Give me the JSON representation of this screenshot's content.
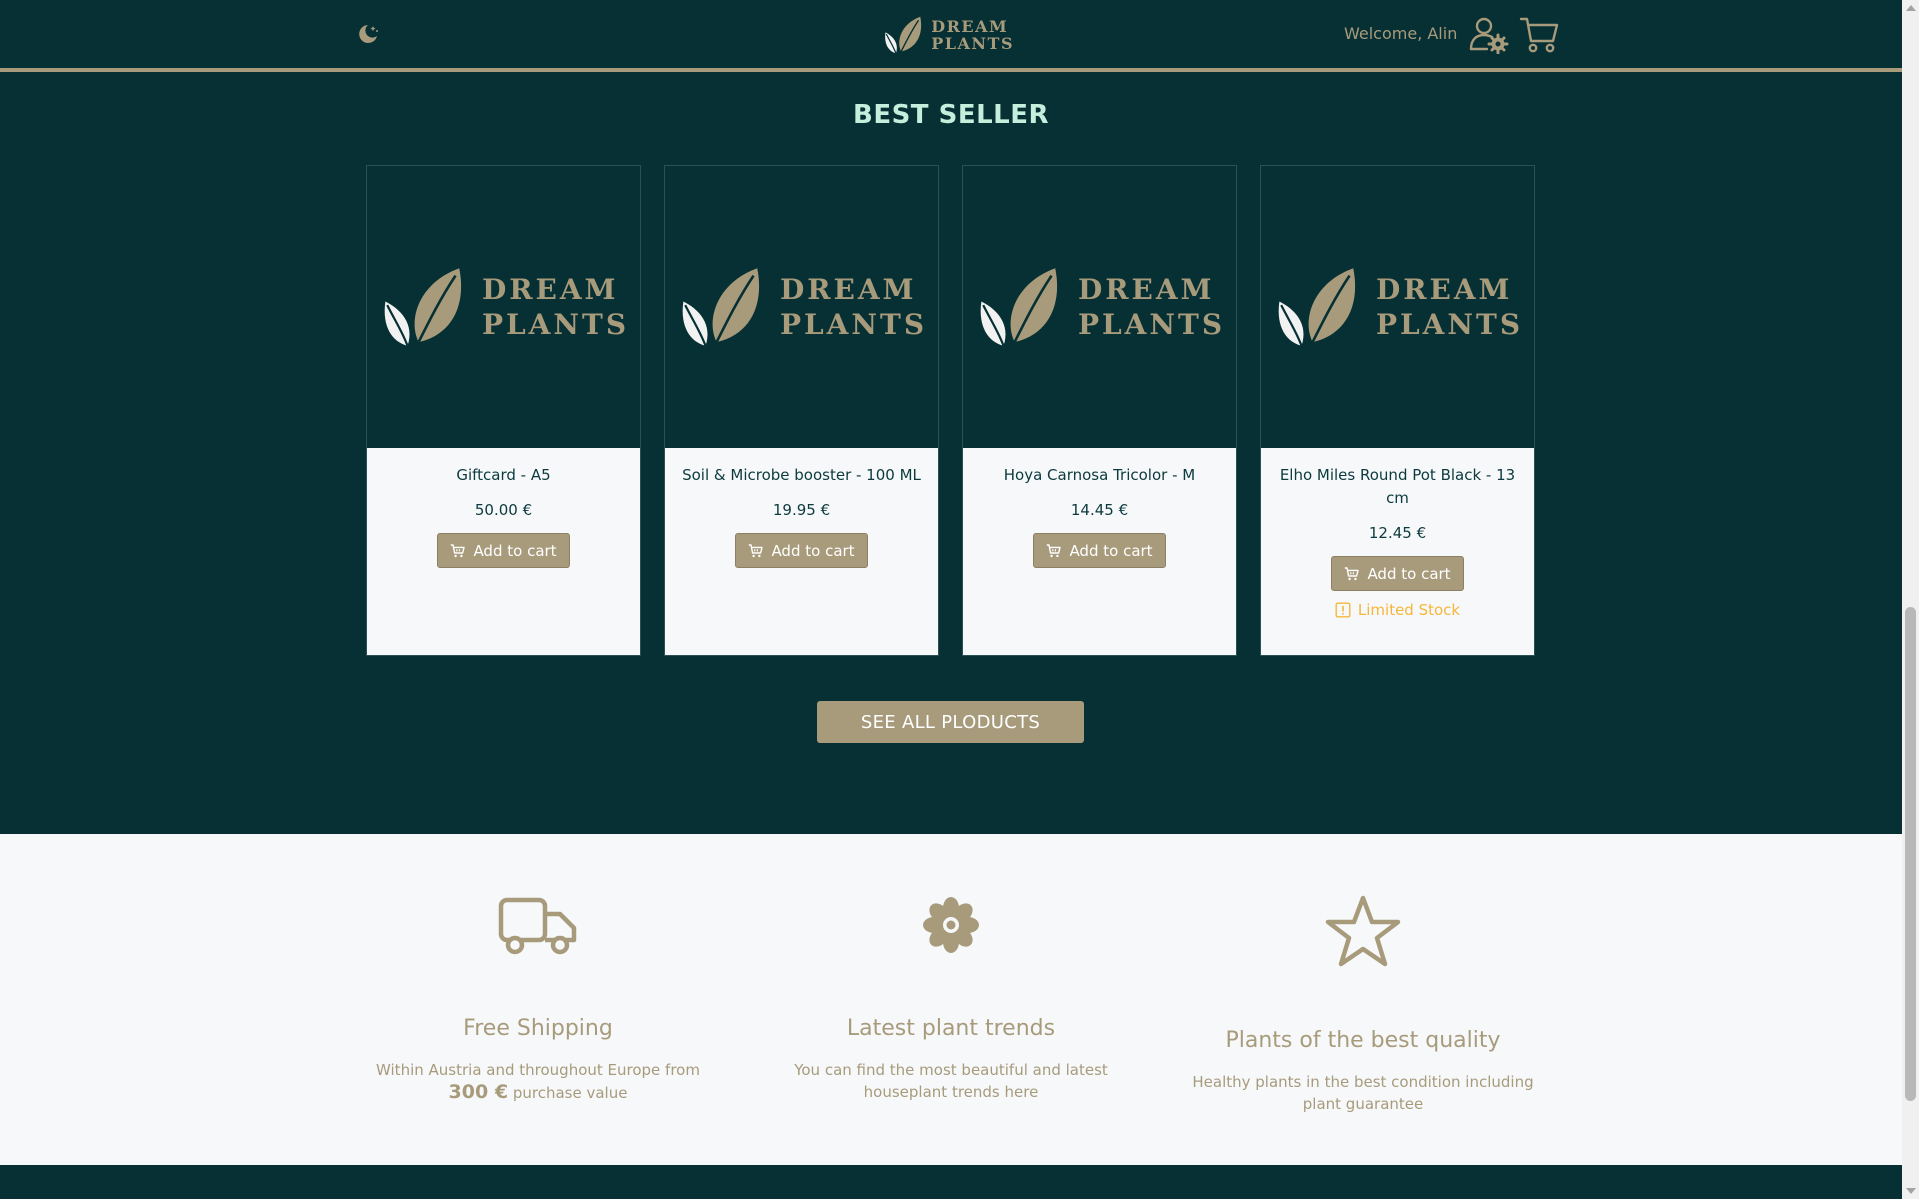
{
  "header": {
    "logo_line1": "DREAM",
    "logo_line2": "PLANTS",
    "welcome": "Welcome, Alin"
  },
  "section_title": "BEST SELLER",
  "products": [
    {
      "name": "Giftcard - A5",
      "price": "50.00 €",
      "button": "Add to cart"
    },
    {
      "name": "Soil & Microbe booster - 100 ML",
      "price": "19.95 €",
      "button": "Add to cart"
    },
    {
      "name": "Hoya Carnosa Tricolor - M",
      "price": "14.45 €",
      "button": "Add to cart"
    },
    {
      "name": "Elho Miles Round Pot Black - 13 cm",
      "price": "12.45 €",
      "button": "Add to cart",
      "stock_note": "Limited Stock"
    }
  ],
  "product_placeholder": {
    "line1": "DREAM",
    "line2": "PLANTS"
  },
  "see_all": "SEE ALL PLODUCTS",
  "features": [
    {
      "icon": "truck-icon",
      "title": "Free Shipping",
      "desc_pre": "Within Austria and throughout Europe from",
      "desc_amount": "300 €",
      "desc_post": "purchase value"
    },
    {
      "icon": "flower-icon",
      "title": "Latest plant trends",
      "desc": "You can find the most beautiful and latest houseplant trends here"
    },
    {
      "icon": "star-icon",
      "title": "Plants of the best quality",
      "desc": "Healthy plants in the best condition including plant guarantee"
    }
  ],
  "colors": {
    "background": "#063033",
    "accent": "#a89b7c",
    "title": "#c5eedc",
    "light": "#f6f8fa",
    "warning": "#f5b73a"
  }
}
